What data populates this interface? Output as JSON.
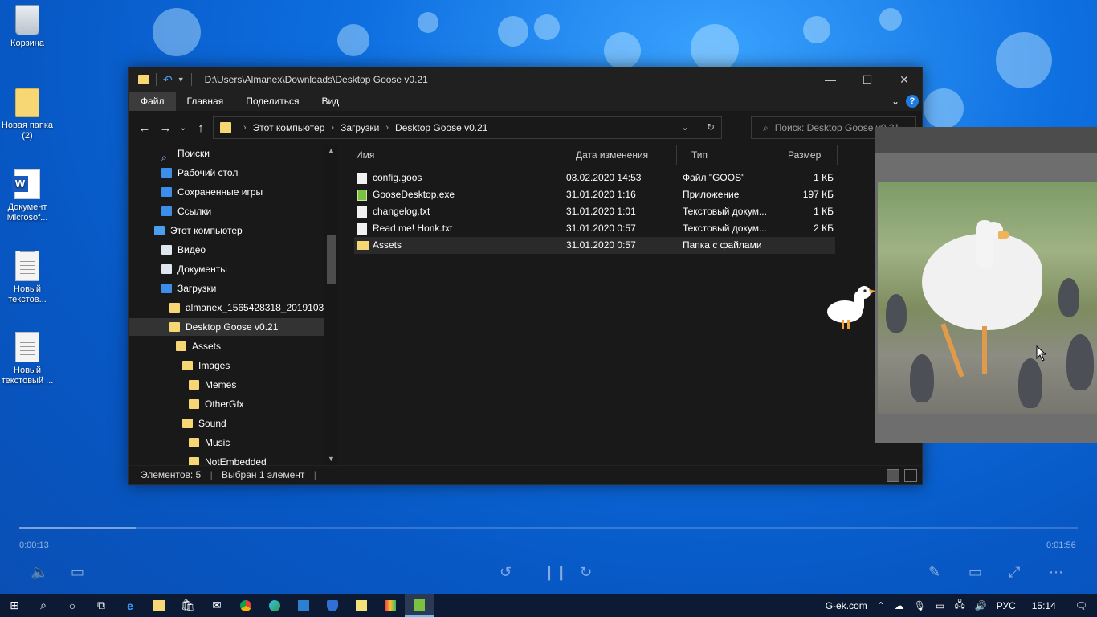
{
  "desktop": {
    "icons": [
      {
        "label": "Корзина",
        "icon": "recycle-bin-icon"
      },
      {
        "label": "Новая папка (2)",
        "icon": "folder-icon"
      },
      {
        "label": "Документ Microsof...",
        "icon": "word-document-icon"
      },
      {
        "label": "Новый текстов...",
        "icon": "text-document-icon"
      },
      {
        "label": "Новый текстовый ...",
        "icon": "text-document-icon"
      }
    ]
  },
  "explorer": {
    "title_path": "D:\\Users\\Almanex\\Downloads\\Desktop Goose v0.21",
    "ribbon_tabs": [
      "Файл",
      "Главная",
      "Поделиться",
      "Вид"
    ],
    "breadcrumb": [
      "Этот компьютер",
      "Загрузки",
      "Desktop Goose v0.21"
    ],
    "search_placeholder": "Поиск: Desktop Goose v0.21",
    "nav_items": [
      {
        "label": "Поиски",
        "icon": "search-icon"
      },
      {
        "label": "Рабочий стол",
        "icon": "desktop-folder-icon"
      },
      {
        "label": "Сохраненные игры",
        "icon": "saved-games-icon"
      },
      {
        "label": "Ссылки",
        "icon": "links-icon"
      },
      {
        "label": "Этот компьютер",
        "icon": "computer-icon"
      },
      {
        "label": "Видео",
        "icon": "video-folder-icon"
      },
      {
        "label": "Документы",
        "icon": "documents-folder-icon"
      },
      {
        "label": "Загрузки",
        "icon": "downloads-folder-icon"
      },
      {
        "label": "almanex_1565428318_20191030",
        "icon": "folder-icon"
      },
      {
        "label": "Desktop Goose v0.21",
        "icon": "folder-icon"
      },
      {
        "label": "Assets",
        "icon": "folder-icon"
      },
      {
        "label": "Images",
        "icon": "folder-icon"
      },
      {
        "label": "Memes",
        "icon": "folder-icon"
      },
      {
        "label": "OtherGfx",
        "icon": "folder-icon"
      },
      {
        "label": "Sound",
        "icon": "folder-icon"
      },
      {
        "label": "Music",
        "icon": "folder-icon"
      },
      {
        "label": "NotEmbedded",
        "icon": "folder-icon"
      }
    ],
    "columns": [
      "Имя",
      "Дата изменения",
      "Тип",
      "Размер"
    ],
    "files": [
      {
        "name": "config.goos",
        "date": "03.02.2020 14:53",
        "type": "Файл \"GOOS\"",
        "size": "1 КБ",
        "icon": "file-icon"
      },
      {
        "name": "GooseDesktop.exe",
        "date": "31.01.2020 1:16",
        "type": "Приложение",
        "size": "197 КБ",
        "icon": "exe-icon"
      },
      {
        "name": "changelog.txt",
        "date": "31.01.2020 1:01",
        "type": "Текстовый докум...",
        "size": "1 КБ",
        "icon": "text-file-icon"
      },
      {
        "name": "Read me! Honk.txt",
        "date": "31.01.2020 0:57",
        "type": "Текстовый докум...",
        "size": "2 КБ",
        "icon": "text-file-icon"
      },
      {
        "name": "Assets",
        "date": "31.01.2020 0:57",
        "type": "Папка с файлами",
        "size": "",
        "icon": "folder-icon"
      }
    ],
    "status_count": "Элементов: 5",
    "status_selected": "Выбран 1 элемент"
  },
  "media": {
    "time_elapsed": "0:00:13",
    "time_total": "0:01:56",
    "progress": 0.11
  },
  "taskbar": {
    "tray_site": "G-ek.com",
    "language": "РУС",
    "clock": "15:14"
  }
}
